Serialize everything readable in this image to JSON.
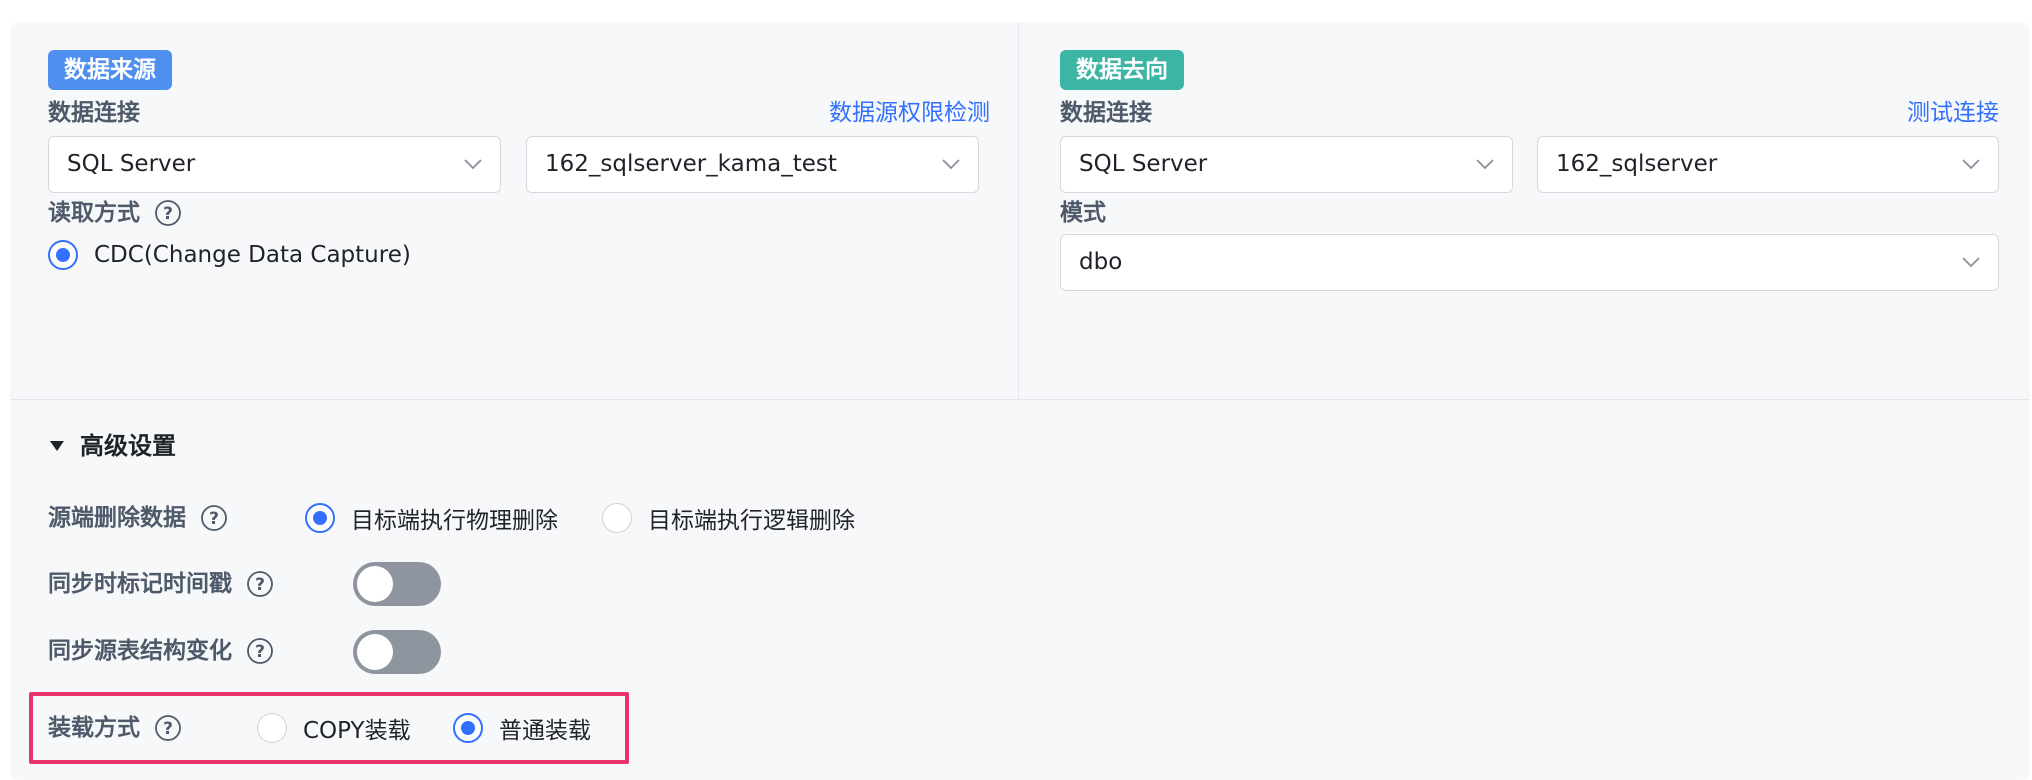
{
  "source": {
    "tag": "数据来源",
    "connection_label": "数据连接",
    "permission_link": "数据源权限检测",
    "db_type": "SQL Server",
    "db_instance": "162_sqlserver_kama_test",
    "read_mode_label": "读取方式",
    "read_mode_option": "CDC(Change Data Capture)",
    "tag_color": "#4f8ff0"
  },
  "target": {
    "tag": "数据去向",
    "connection_label": "数据连接",
    "test_link": "测试连接",
    "db_type": "SQL Server",
    "db_instance": "162_sqlserver",
    "schema_label": "模式",
    "schema_value": "dbo",
    "tag_color": "#3db5a4"
  },
  "advanced": {
    "title": "高级设置",
    "delete_label": "源端删除数据",
    "delete_options": [
      "目标端执行物理删除",
      "目标端执行逻辑删除"
    ],
    "delete_selected": 0,
    "timestamp_label": "同步时标记时间戳",
    "timestamp_enabled": false,
    "schema_change_label": "同步源表结构变化",
    "schema_change_enabled": false,
    "load_label": "装载方式",
    "load_options": [
      "COPY装载",
      "普通装载"
    ],
    "load_selected": 1
  },
  "colors": {
    "accent": "#3370ff",
    "highlight": "#e8336d"
  }
}
